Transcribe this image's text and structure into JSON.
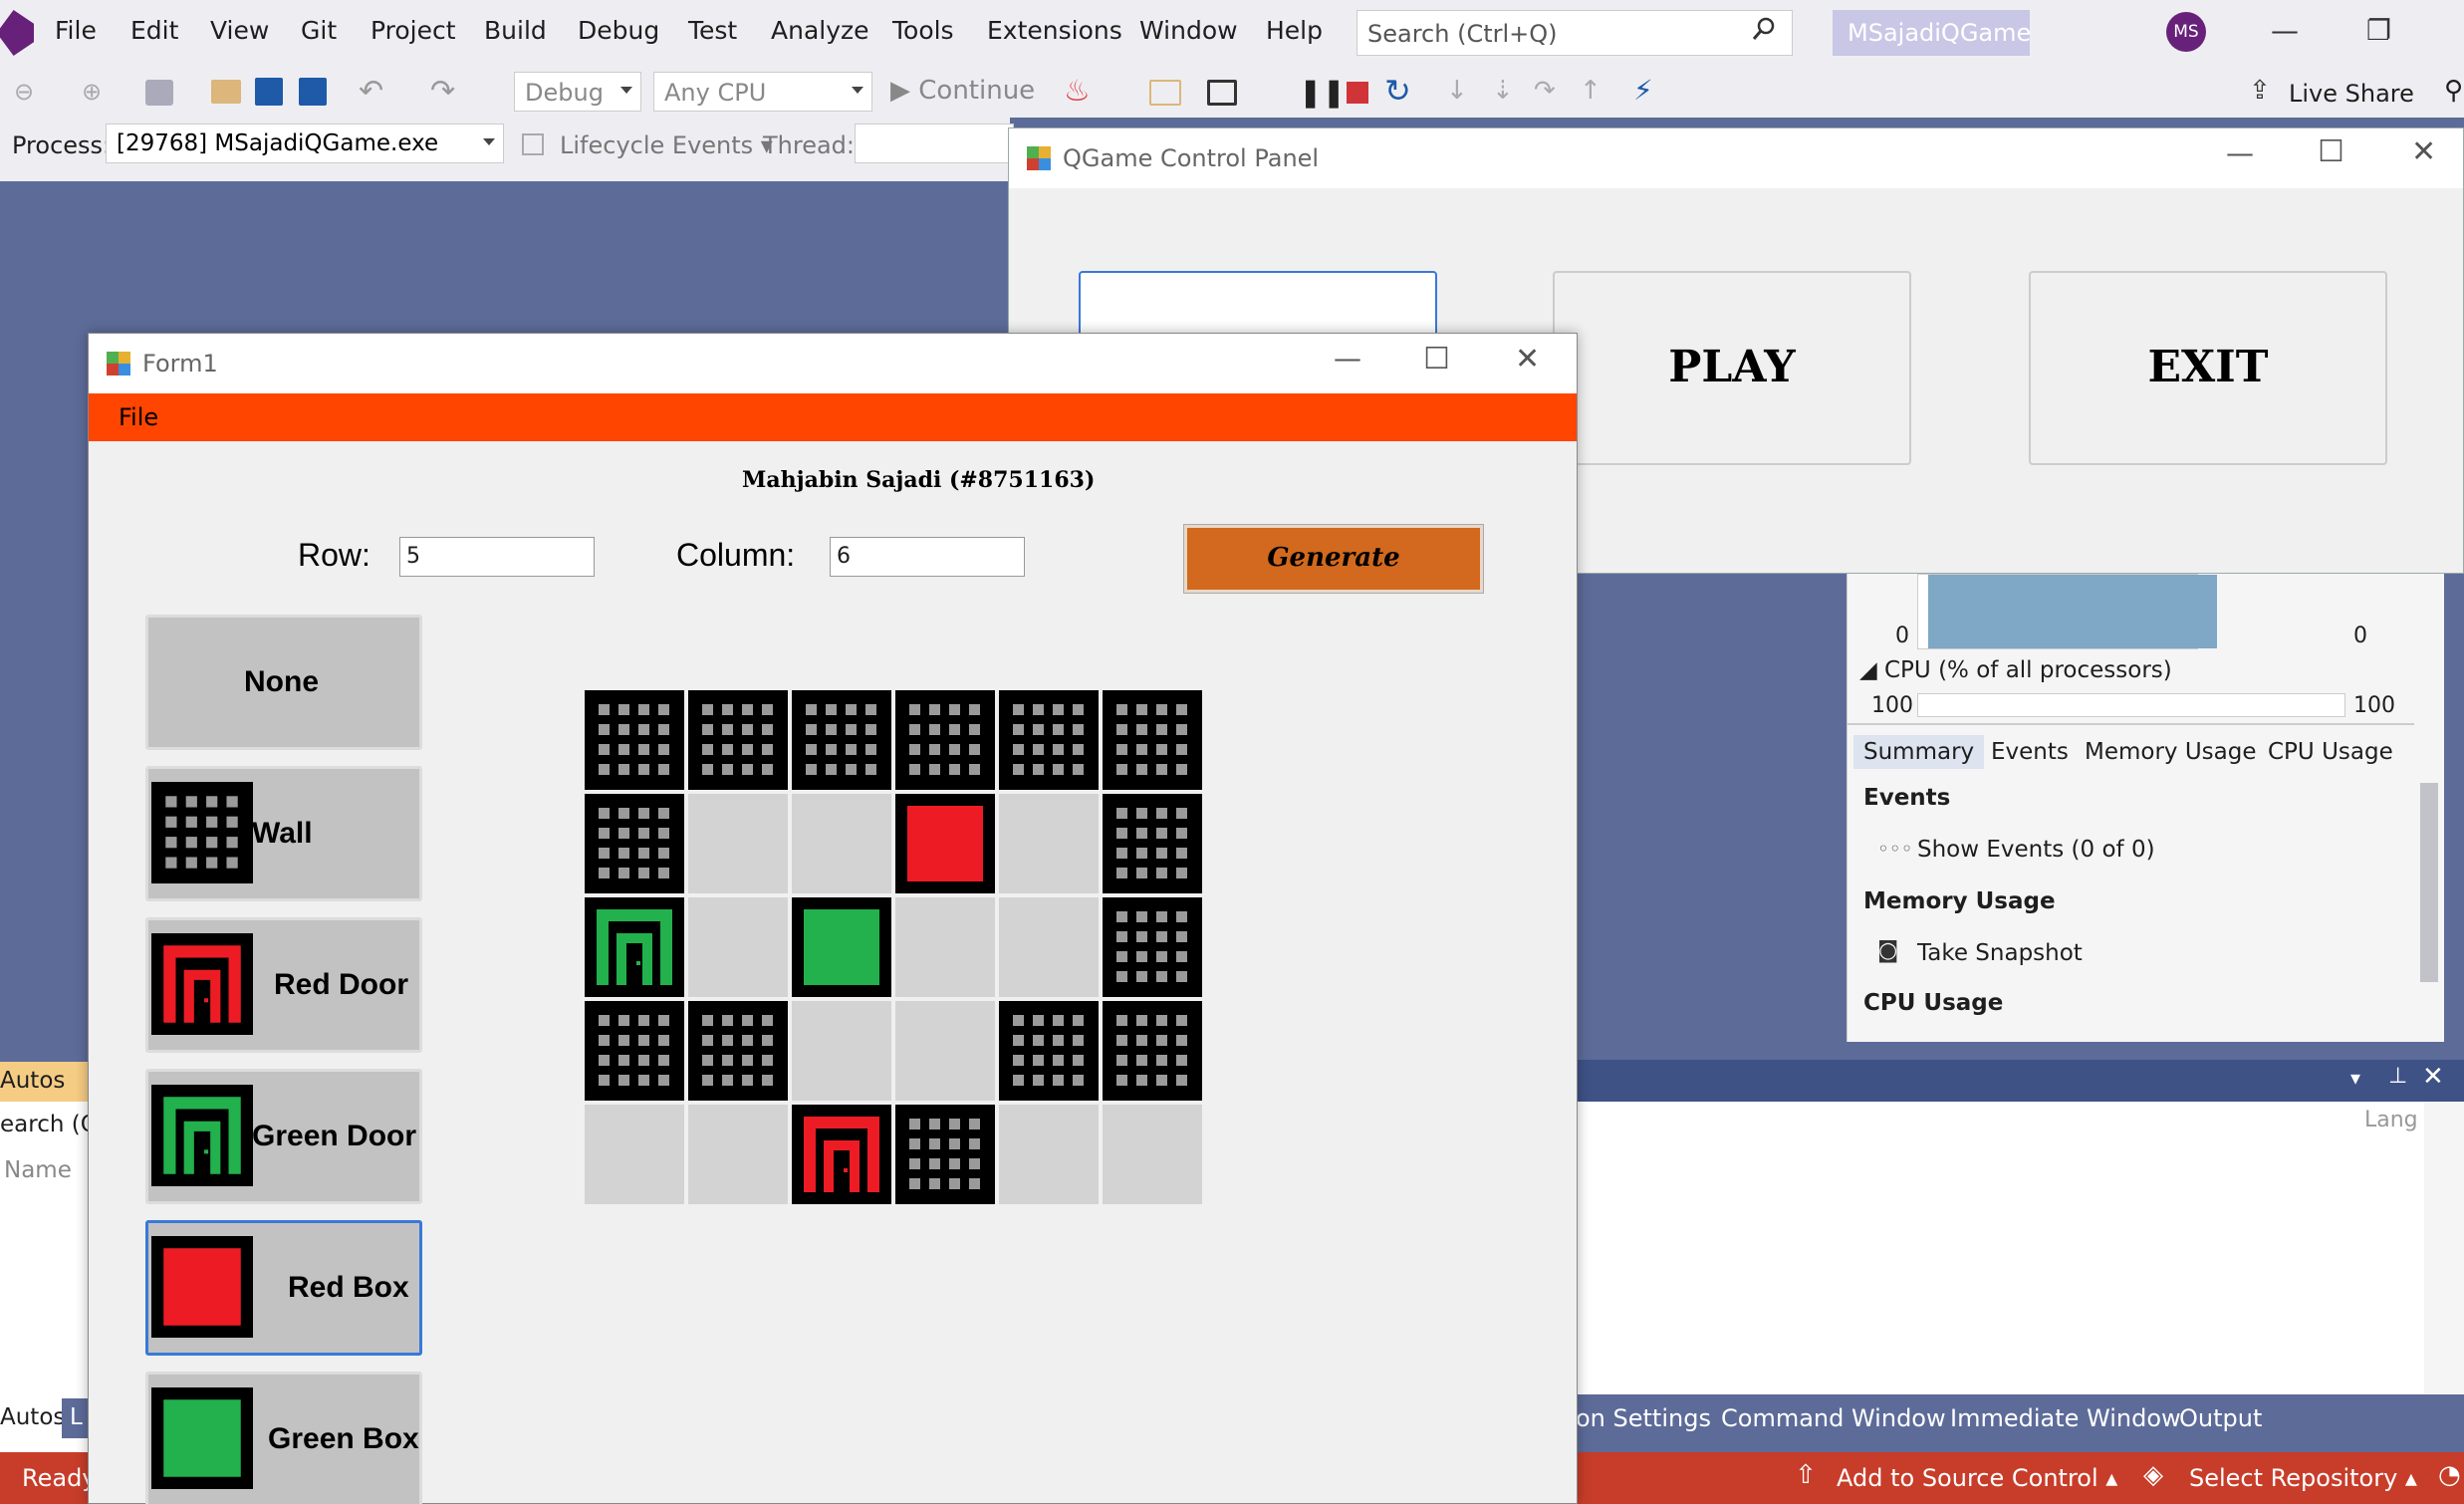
{
  "vs": {
    "menu": [
      "File",
      "Edit",
      "View",
      "Git",
      "Project",
      "Build",
      "Debug",
      "Test",
      "Analyze",
      "Tools",
      "Extensions",
      "Window",
      "Help"
    ],
    "search_placeholder": "Search (Ctrl+Q)",
    "solution_name": "MSajadiQGame",
    "avatar_initials": "MS",
    "toolbar": {
      "config": "Debug",
      "platform": "Any CPU",
      "continue_label": "Continue",
      "live_share": "Live Share"
    },
    "debug_row": {
      "process_label": "Process:",
      "process_value": "[29768] MSajadiQGame.exe",
      "lifecycle": "Lifecycle Events",
      "thread_label": "Thread:"
    },
    "diagnostics": {
      "axis_left_bottom": "0",
      "axis_right_bottom": "0",
      "cpu_header": "CPU (% of all processors)",
      "axis_left_top": "100",
      "axis_right_top": "100",
      "tabs": [
        "Summary",
        "Events",
        "Memory Usage",
        "CPU Usage"
      ],
      "sections": {
        "events": "Events",
        "show_events": "Show Events (0 of 0)",
        "memory": "Memory Usage",
        "take_snapshot": "Take Snapshot",
        "cpu": "CPU Usage"
      }
    },
    "output": {
      "lang_col": "Lang"
    },
    "bottom_tabs": [
      "on Settings",
      "Command Window",
      "Immediate Window",
      "Output"
    ],
    "autos": {
      "title": "Autos",
      "search": "earch (C",
      "name_col": "Name",
      "tab_autos": "Autos",
      "tab_l": "L"
    },
    "status": {
      "ready": "Ready",
      "add_source": "Add to Source Control",
      "select_repo": "Select Repository"
    }
  },
  "qgame": {
    "title": "QGame Control Panel",
    "buttons": {
      "first": "",
      "play": "PLAY",
      "exit": "EXIT"
    }
  },
  "form1": {
    "title": "Form1",
    "menu_file": "File",
    "author": "Mahjabin Sajadi (#8751163)",
    "row_label": "Row:",
    "row_value": "5",
    "column_label": "Column:",
    "column_value": "6",
    "generate": "Generate",
    "tools": [
      "None",
      "Wall",
      "Red Door",
      "Green Door",
      "Red Box",
      "Green Box"
    ],
    "selected_tool": "Red Box",
    "grid": [
      [
        "wall",
        "wall",
        "wall",
        "wall",
        "wall",
        "wall"
      ],
      [
        "wall",
        "none",
        "none",
        "redbox",
        "none",
        "wall"
      ],
      [
        "greendoor",
        "none",
        "greenbox",
        "none",
        "none",
        "wall"
      ],
      [
        "wall",
        "wall",
        "none",
        "none",
        "wall",
        "wall"
      ],
      [
        "none",
        "none",
        "reddoor",
        "wall",
        "none",
        "none"
      ]
    ]
  },
  "colors": {
    "accent_orange": "#ff4500",
    "generate_bg": "#d2691e",
    "red": "#ed1c24",
    "green": "#22b14c",
    "status_bar": "#c73d2a"
  }
}
